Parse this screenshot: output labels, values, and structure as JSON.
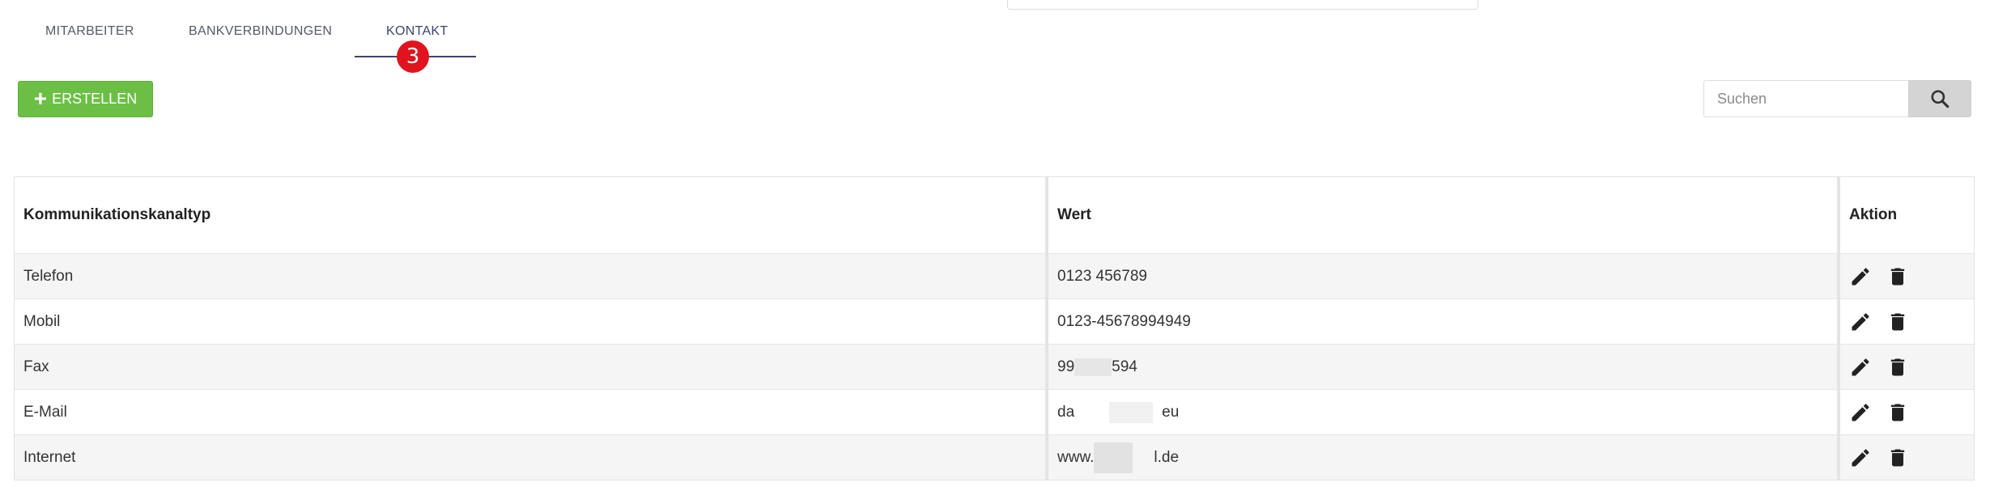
{
  "tabs": [
    {
      "label": "MITARBEITER",
      "active": false
    },
    {
      "label": "BANKVERBINDUNGEN",
      "active": false
    },
    {
      "label": "KONTAKT",
      "active": true,
      "badge": "3"
    }
  ],
  "toolbar": {
    "create_label": "ERSTELLEN",
    "create_icon": "plus-icon",
    "search_placeholder": "Suchen",
    "search_icon": "search-icon"
  },
  "table": {
    "headers": [
      "Kommunikationskanaltyp",
      "Wert",
      "Aktion"
    ],
    "rows": [
      {
        "type": "Telefon",
        "value_start": "0123 456789",
        "value_end": ""
      },
      {
        "type": "Mobil",
        "value_start": "0123-45678994949",
        "value_end": ""
      },
      {
        "type": "Fax",
        "value_start": "99",
        "value_end": "594"
      },
      {
        "type": "E-Mail",
        "value_start": "da",
        "value_end": "eu"
      },
      {
        "type": "Internet",
        "value_start": "www.",
        "value_end": "l.de"
      }
    ],
    "action_icons": [
      "pencil-icon",
      "trash-icon"
    ]
  },
  "colors": {
    "create_button": "#6cbf45",
    "tab_active": "#3a4570",
    "badge": "#e0141e",
    "search_button": "#d4d4d4"
  }
}
